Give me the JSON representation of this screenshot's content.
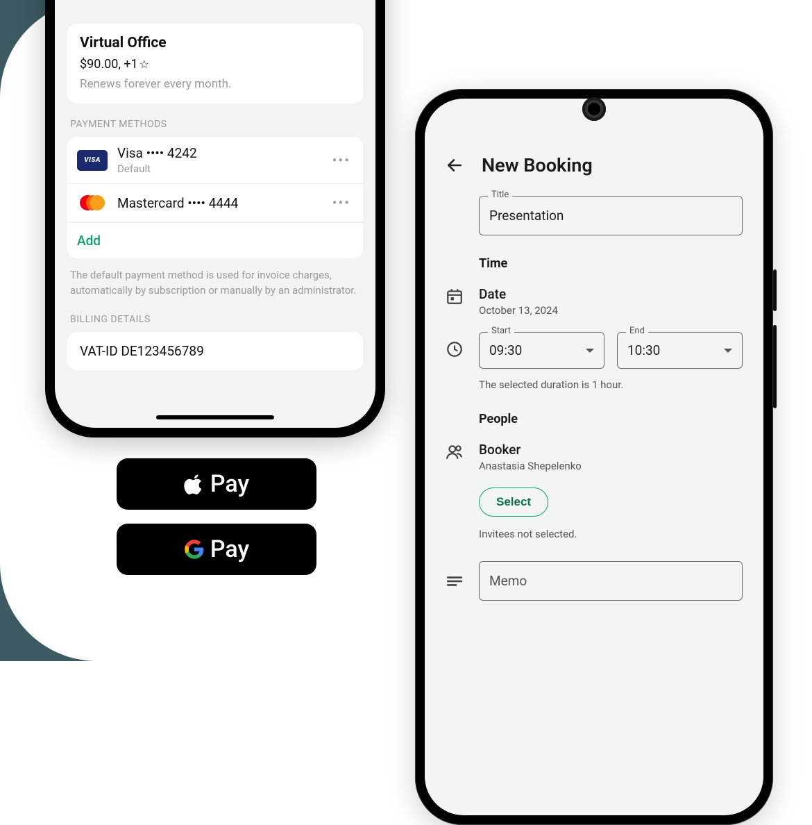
{
  "left": {
    "plan": {
      "title": "Virtual Office",
      "price": "$90.00, +1",
      "star": "☆",
      "renews": "Renews forever every month."
    },
    "payment_methods_label": "PAYMENT METHODS",
    "cards": [
      {
        "brand": "VISA",
        "name": "Visa •••• 4242",
        "sub": "Default"
      },
      {
        "brand": "MC",
        "name": "Mastercard •••• 4444",
        "sub": ""
      }
    ],
    "add_label": "Add",
    "pm_note": "The default payment method is used for invoice charges, automatically by subscription or manually by an administrator.",
    "billing_label": "BILLING DETAILS",
    "vat": "VAT-ID DE123456789"
  },
  "pay": {
    "apple": "Pay",
    "google": "Pay"
  },
  "right": {
    "title": "New Booking",
    "title_field_label": "Title",
    "title_field_value": "Presentation",
    "time_label": "Time",
    "date_label": "Date",
    "date_value": "October 13, 2024",
    "start_label": "Start",
    "start_value": "09:30",
    "end_label": "End",
    "end_value": "10:30",
    "duration_note": "The selected duration is 1 hour.",
    "people_label": "People",
    "booker_label": "Booker",
    "booker_name": "Anastasia Shepelenko",
    "select_btn": "Select",
    "invitees_note": "Invitees not selected.",
    "memo_label": "Memo"
  }
}
